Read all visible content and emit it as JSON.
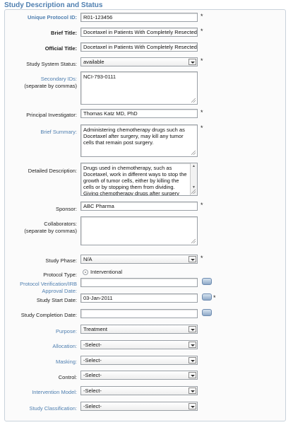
{
  "page_title": "Study Description and Status",
  "required_mark": "*",
  "fields": {
    "unique_protocol_id": {
      "label": "Unique Protocol ID:",
      "value": "R01-123456"
    },
    "brief_title": {
      "label": "Brief Title:",
      "value": "Docetaxel in Patients With Completely Resected N"
    },
    "official_title": {
      "label": "Official Title:",
      "value": "Docetaxel in Patients With Completely Resected"
    },
    "study_system_status": {
      "label": "Study System Status:",
      "value": "available"
    },
    "secondary_ids": {
      "label": "Secondary IDs:",
      "sublabel": "(separate by commas)",
      "value": "NCI-793-0111"
    },
    "principal_investigator": {
      "label": "Principal Investigator:",
      "value": "Thomas Katz  MD, PhD"
    },
    "brief_summary": {
      "label": "Brief Summary:",
      "value": "Administering chemotherapy drugs such as Docetaxel after surgery, may kill any tumor cells that remain post surgery."
    },
    "detailed_description": {
      "label": "Detailed Description:",
      "value": "Drugs used in chemotherapy, such as Docetaxel, work in different ways to stop the growth of tumor cells, either by killing the cells or by stopping them from dividing. Giving chemotherapy drugs after surgery may kill any tumor cells that remain post"
    },
    "sponsor": {
      "label": "Sponsor:",
      "value": "ABC Pharma"
    },
    "collaborators": {
      "label": "Collaborators:",
      "sublabel": "(separate by commas)",
      "value": ""
    },
    "study_phase": {
      "label": "Study Phase:",
      "value": "N/A"
    },
    "protocol_type": {
      "label": "Protocol Type:",
      "value": "Interventional"
    },
    "protocol_verification": {
      "label": "Protocol Verification/IRB",
      "sublabel": "Approval Date:",
      "value": ""
    },
    "study_start_date": {
      "label": "Study Start Date:",
      "value": "03-Jan-2011"
    },
    "study_completion_date": {
      "label": "Study Completion Date:",
      "value": ""
    },
    "purpose": {
      "label": "Purpose:",
      "value": "Treatment"
    },
    "allocation": {
      "label": "Allocation:",
      "value": "-Select-"
    },
    "masking": {
      "label": "Masking:",
      "value": "-Select-"
    },
    "control": {
      "label": "Control:",
      "value": "-Select-"
    },
    "intervention_model": {
      "label": "Intervention Model:",
      "value": "-Select-"
    },
    "study_classification": {
      "label": "Study Classification:",
      "value": "-Select-"
    }
  },
  "colors": {
    "link": "#4f7fb0",
    "title": "#4f7fb0",
    "border": "#9aa0a6"
  },
  "icons": {
    "calendar": "calendar-icon",
    "dropdown": "chevron-down-icon",
    "resize": "resize-grip-icon"
  }
}
